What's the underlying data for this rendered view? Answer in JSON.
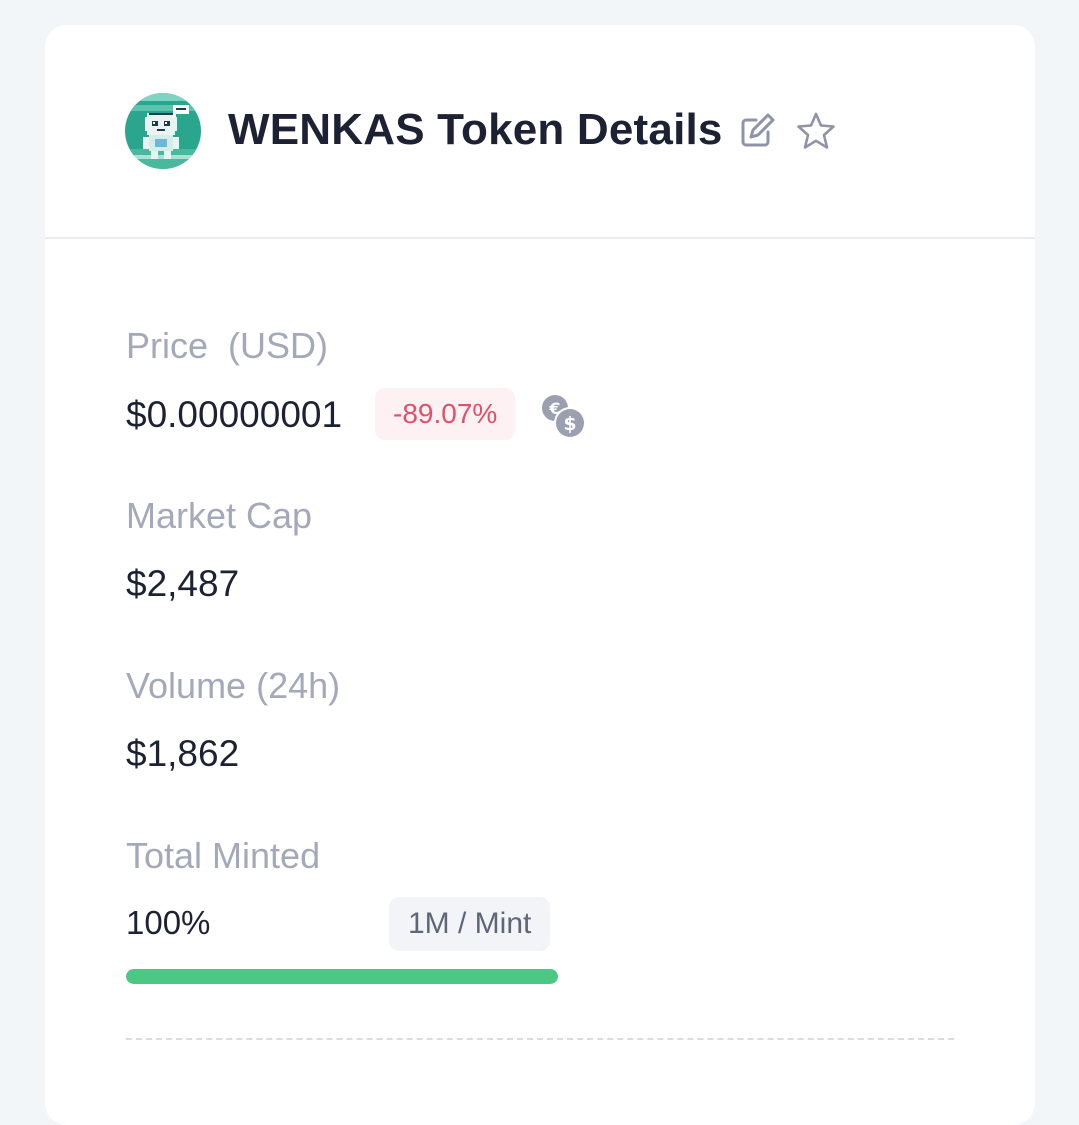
{
  "header": {
    "title": "WENKAS Token Details",
    "avatar_icon": "pixel-robot-avatar",
    "edit_icon": "edit-icon",
    "favorite_icon": "star-icon"
  },
  "price": {
    "label": "Price  (USD)",
    "value": "$0.00000001",
    "change": "-89.07%",
    "change_color": "#e0506b",
    "currency_toggle_icon": "currency-exchange-icon"
  },
  "market_cap": {
    "label": "Market Cap",
    "value": "$2,487"
  },
  "volume": {
    "label": "Volume (24h)",
    "value": "$1,862"
  },
  "total_minted": {
    "label": "Total Minted",
    "value": "100%",
    "progress": 1.0,
    "per_mint": "1M / Mint",
    "progress_color": "#4cc784"
  }
}
